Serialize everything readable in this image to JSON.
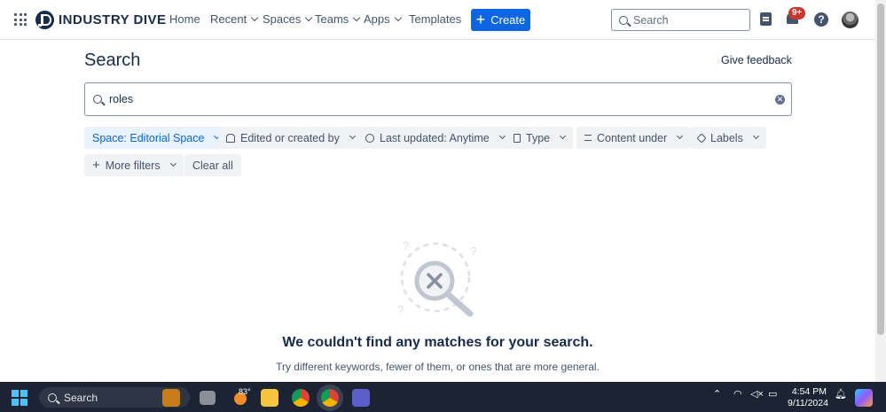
{
  "nav": {
    "brand": "INDUSTRY DIVE",
    "items": [
      "Home",
      "Recent",
      "Spaces",
      "Teams",
      "Apps",
      "Templates"
    ],
    "create_label": "Create",
    "search_placeholder": "Search",
    "notification_badge": "9+",
    "help_glyph": "?"
  },
  "page": {
    "title": "Search",
    "feedback": "Give feedback",
    "query": "roles"
  },
  "filters": [
    {
      "label": "Space: Editorial Space",
      "icon": "",
      "active": true
    },
    {
      "label": "Edited or created by",
      "icon": "people-icon"
    },
    {
      "label": "Last updated: Anytime",
      "icon": "clock-icon"
    },
    {
      "label": "Type",
      "icon": "document-icon"
    },
    {
      "label": "Content under",
      "icon": "list-icon"
    },
    {
      "label": "Labels",
      "icon": "tag-icon"
    },
    {
      "label": "More filters",
      "icon": "plus-icon"
    },
    {
      "label": "Clear all",
      "icon": ""
    }
  ],
  "empty_state": {
    "title": "We couldn't find any matches for your search.",
    "subtitle": "Try different keywords, fewer of them, or ones that are more general."
  },
  "taskbar": {
    "search_placeholder": "Search",
    "temperature": "83°",
    "time": "4:54 PM",
    "date": "9/11/2024"
  },
  "colors": {
    "accent": "#0c66e4",
    "text": "#172b4d",
    "taskbar": "#1c2434"
  }
}
